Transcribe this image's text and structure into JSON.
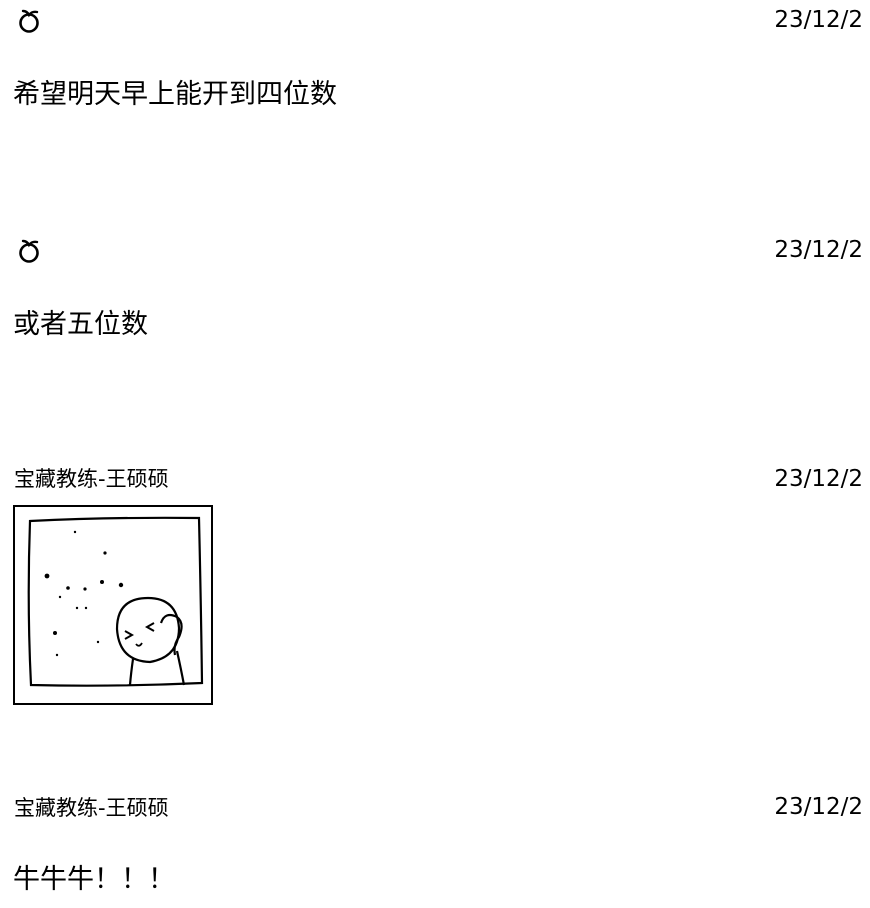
{
  "messages": [
    {
      "sender_icon": "peach-icon",
      "date": "23/12/2",
      "text": "希望明天早上能开到四位数"
    },
    {
      "sender_icon": "peach-icon",
      "date": "23/12/2",
      "text": "或者五位数"
    },
    {
      "sender_name": "宝藏教练-王硕硕",
      "date": "23/12/2",
      "attachment": "cartoon-sticker-image"
    },
    {
      "sender_name": "宝藏教练-王硕硕",
      "date": "23/12/2",
      "text": "牛牛牛！！！"
    }
  ]
}
